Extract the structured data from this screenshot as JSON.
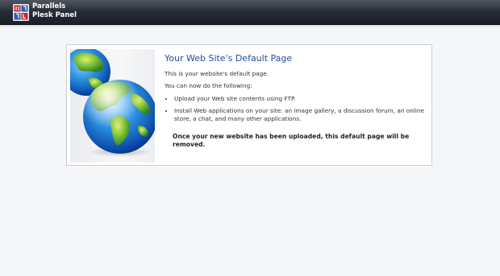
{
  "header": {
    "brand_line1": "Parallels",
    "brand_line2": "Plesk Panel"
  },
  "main": {
    "title": "Your Web Site's Default Page",
    "intro": "This is your website's default page.",
    "lead": "You can now do the following:",
    "items": [
      "Upload your Web site contents using FTP.",
      "Install Web applications on your site: an image gallery, a discussion forum, an online store, a chat, and many other applications."
    ],
    "note": "Once your new website has been uploaded, this default page will be removed."
  },
  "colors": {
    "title": "#1f4e9a",
    "header_bg": "#262a33",
    "page_bg": "#f4f6f8"
  },
  "icons": [
    "parallels-logo-icon",
    "globe-icon"
  ]
}
